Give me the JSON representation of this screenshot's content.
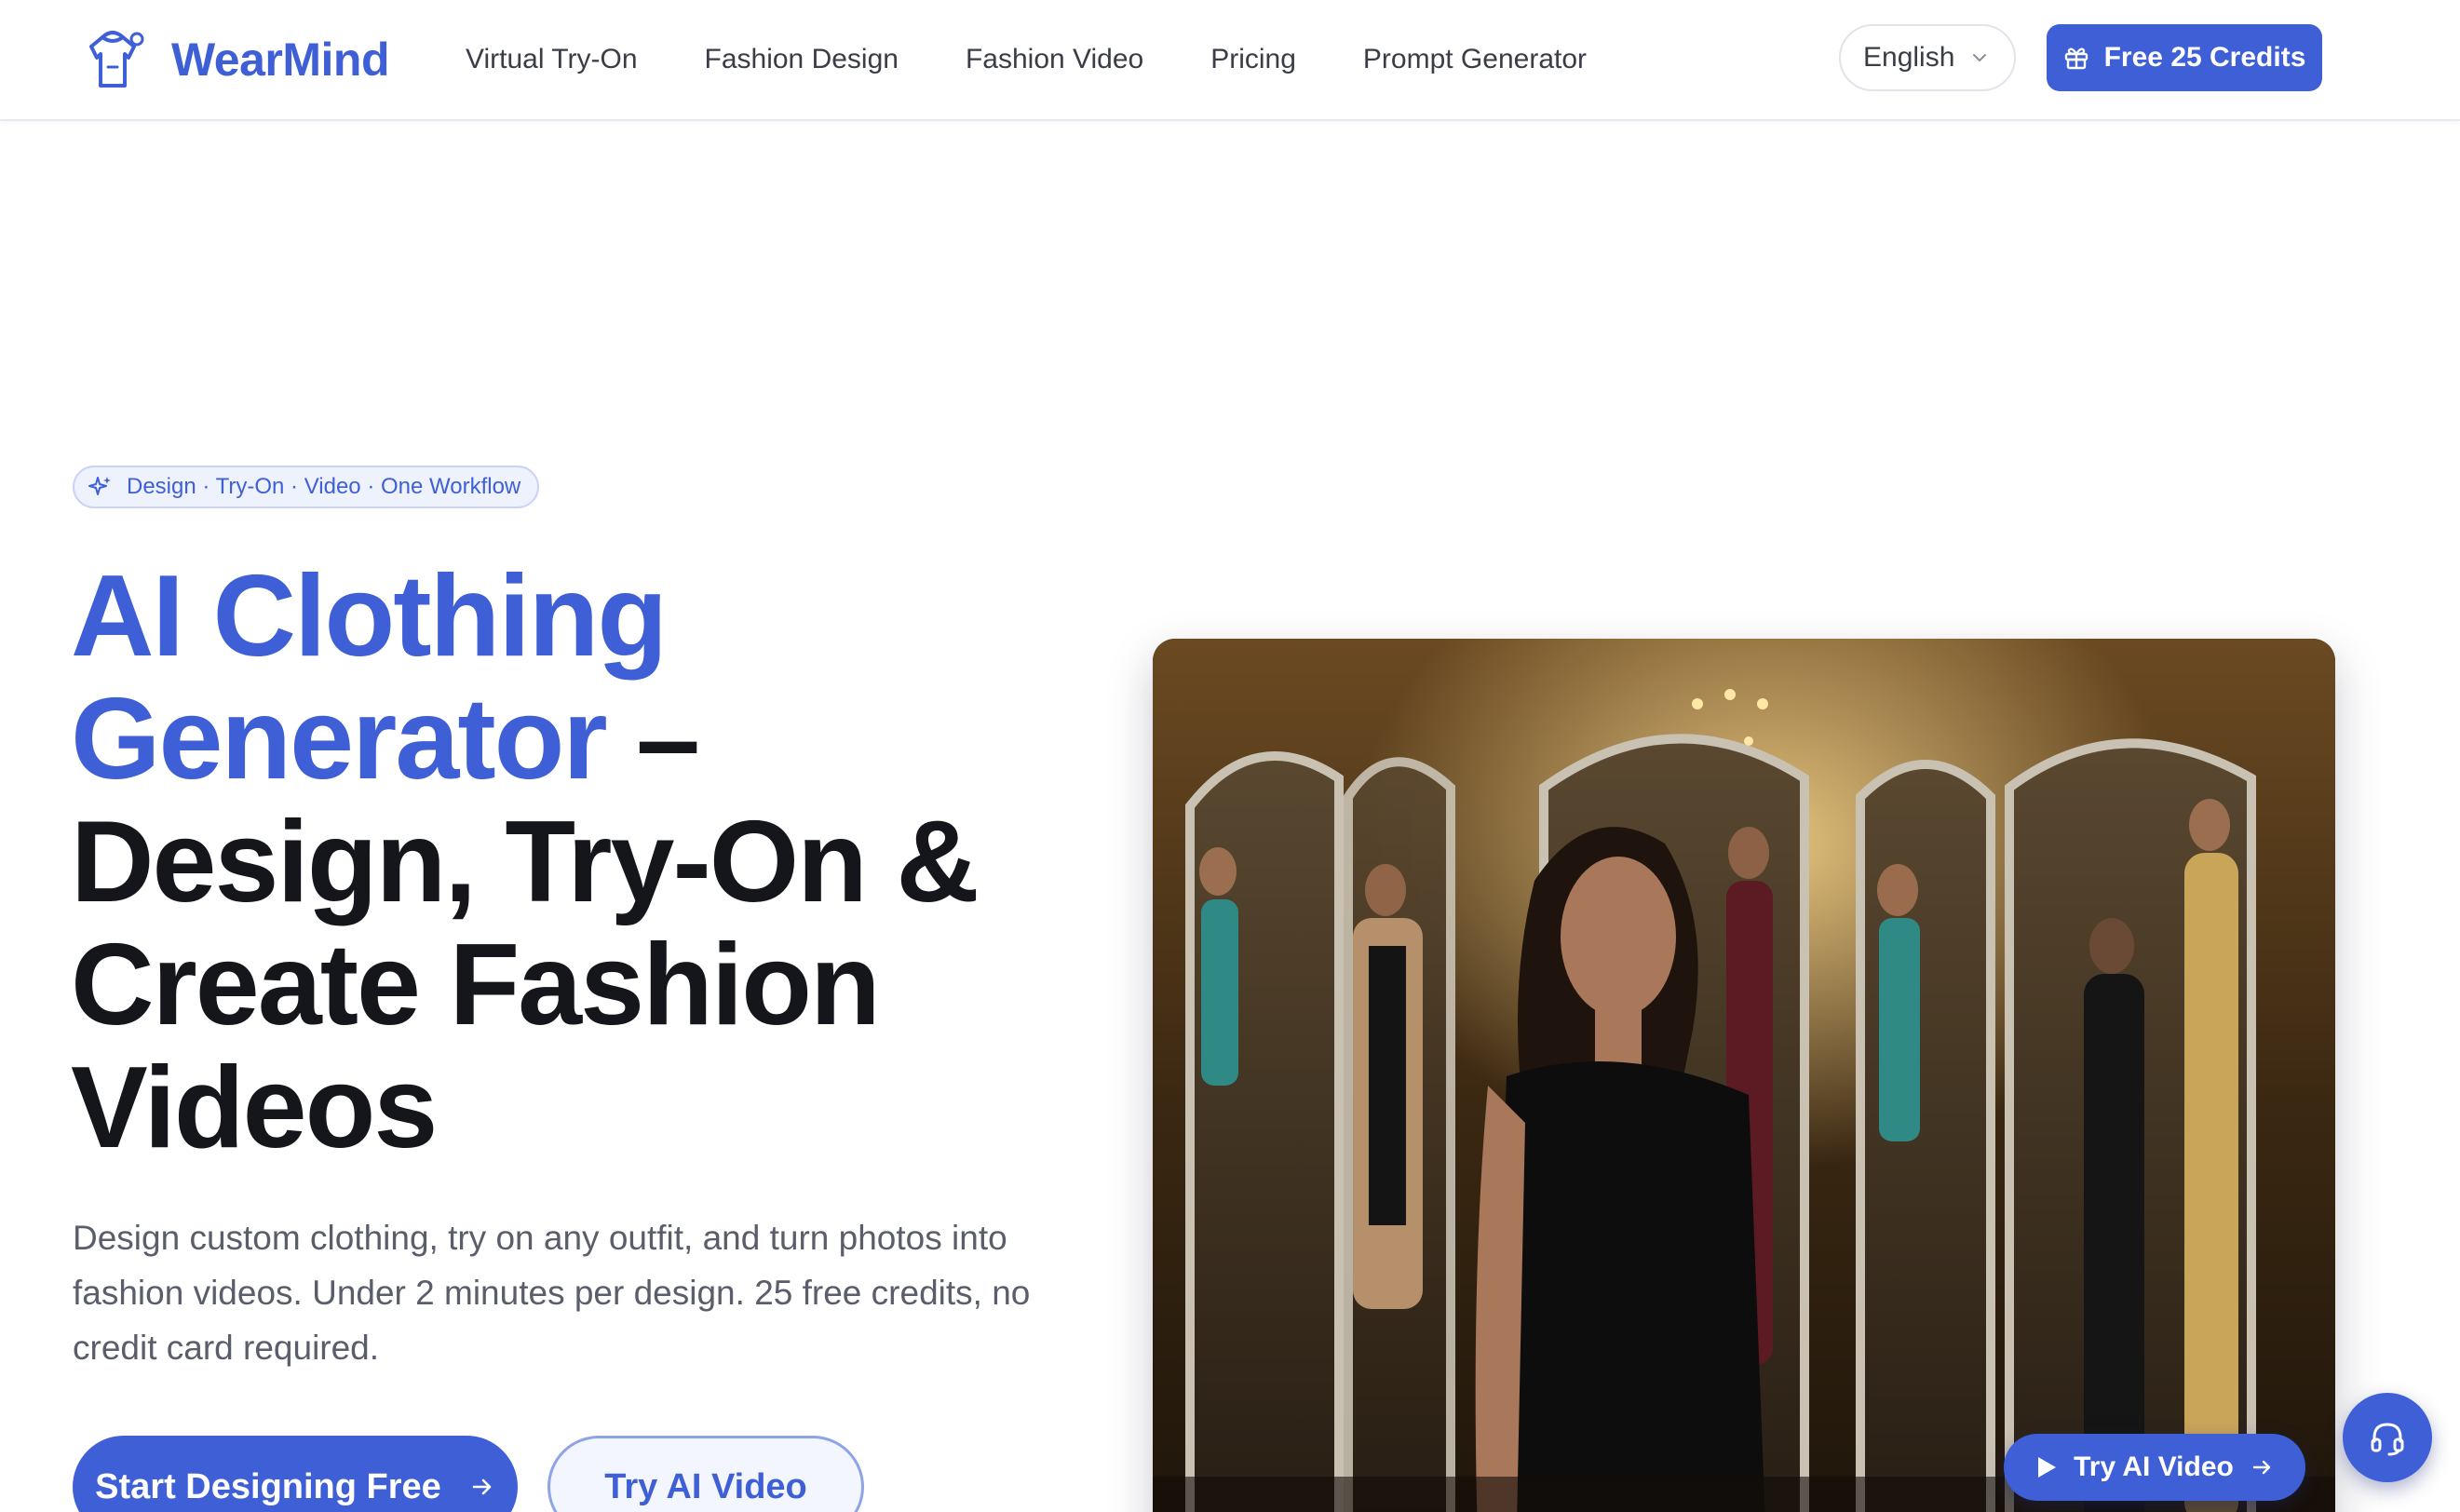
{
  "brand": {
    "name": "WearMind",
    "accent": "#3f5fd6"
  },
  "nav": {
    "items": [
      {
        "label": "Virtual Try-On"
      },
      {
        "label": "Fashion Design"
      },
      {
        "label": "Fashion Video"
      },
      {
        "label": "Pricing"
      },
      {
        "label": "Prompt Generator"
      }
    ]
  },
  "header": {
    "language": "English",
    "credits_label": "Free 25 Credits"
  },
  "hero": {
    "badge": "Design · Try-On · Video · One Workflow",
    "title_accent_1": "AI Clothing",
    "title_accent_2": "Generator",
    "title_dash": " –",
    "title_rest_1": "Design, Try-On &",
    "title_rest_2": "Create Fashion",
    "title_rest_3": "Videos",
    "description": "Design custom clothing, try on any outfit, and turn photos into fashion videos. Under 2 minutes per design. 25 free credits, no credit card required.",
    "primary_cta": "Start Designing Free",
    "secondary_cta": "Try AI Video",
    "media_cta": "Try AI Video"
  },
  "icons": {
    "logo": "shirt-hanger-icon",
    "language_chevron": "chevron-down-icon",
    "credits": "gift-icon",
    "badge": "sparkles-icon",
    "primary_arrow": "arrow-right-icon",
    "play": "play-icon",
    "support": "headset-icon"
  }
}
